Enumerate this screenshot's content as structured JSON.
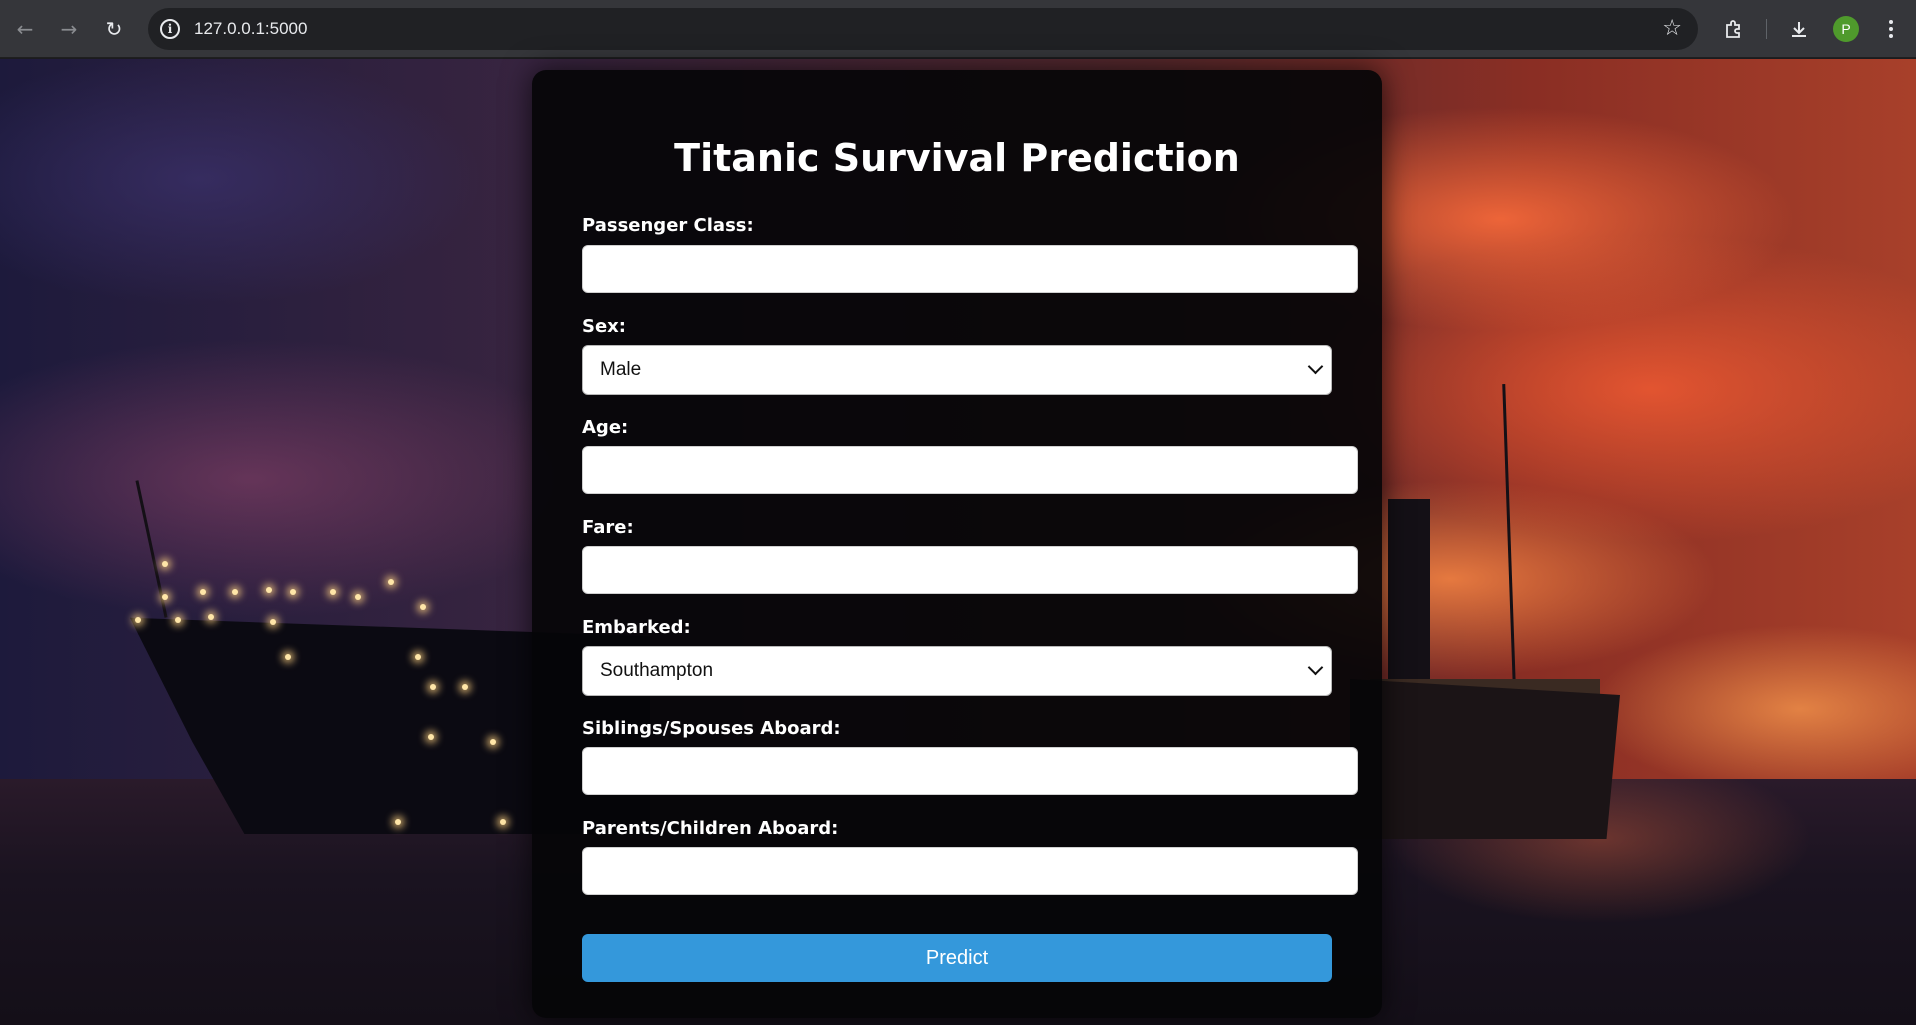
{
  "browser": {
    "url": "127.0.0.1:5000",
    "profile_initial": "P",
    "icons": [
      "back-icon",
      "forward-icon",
      "reload-icon",
      "info-icon",
      "star-icon",
      "extensions-icon",
      "download-icon",
      "menu-icon"
    ]
  },
  "form": {
    "title": "Titanic Survival Prediction",
    "fields": {
      "pclass": {
        "label": "Passenger Class:",
        "value": ""
      },
      "sex": {
        "label": "Sex:",
        "selected": "Male"
      },
      "age": {
        "label": "Age:",
        "value": ""
      },
      "fare": {
        "label": "Fare:",
        "value": ""
      },
      "embarked": {
        "label": "Embarked:",
        "selected": "Southampton"
      },
      "sibsp": {
        "label": "Siblings/Spouses Aboard:",
        "value": ""
      },
      "parch": {
        "label": "Parents/Children Aboard:",
        "value": ""
      }
    },
    "submit_label": "Predict"
  },
  "colors": {
    "button": "#3498db",
    "card": "#050508",
    "avatar": "#4f9a2c"
  }
}
